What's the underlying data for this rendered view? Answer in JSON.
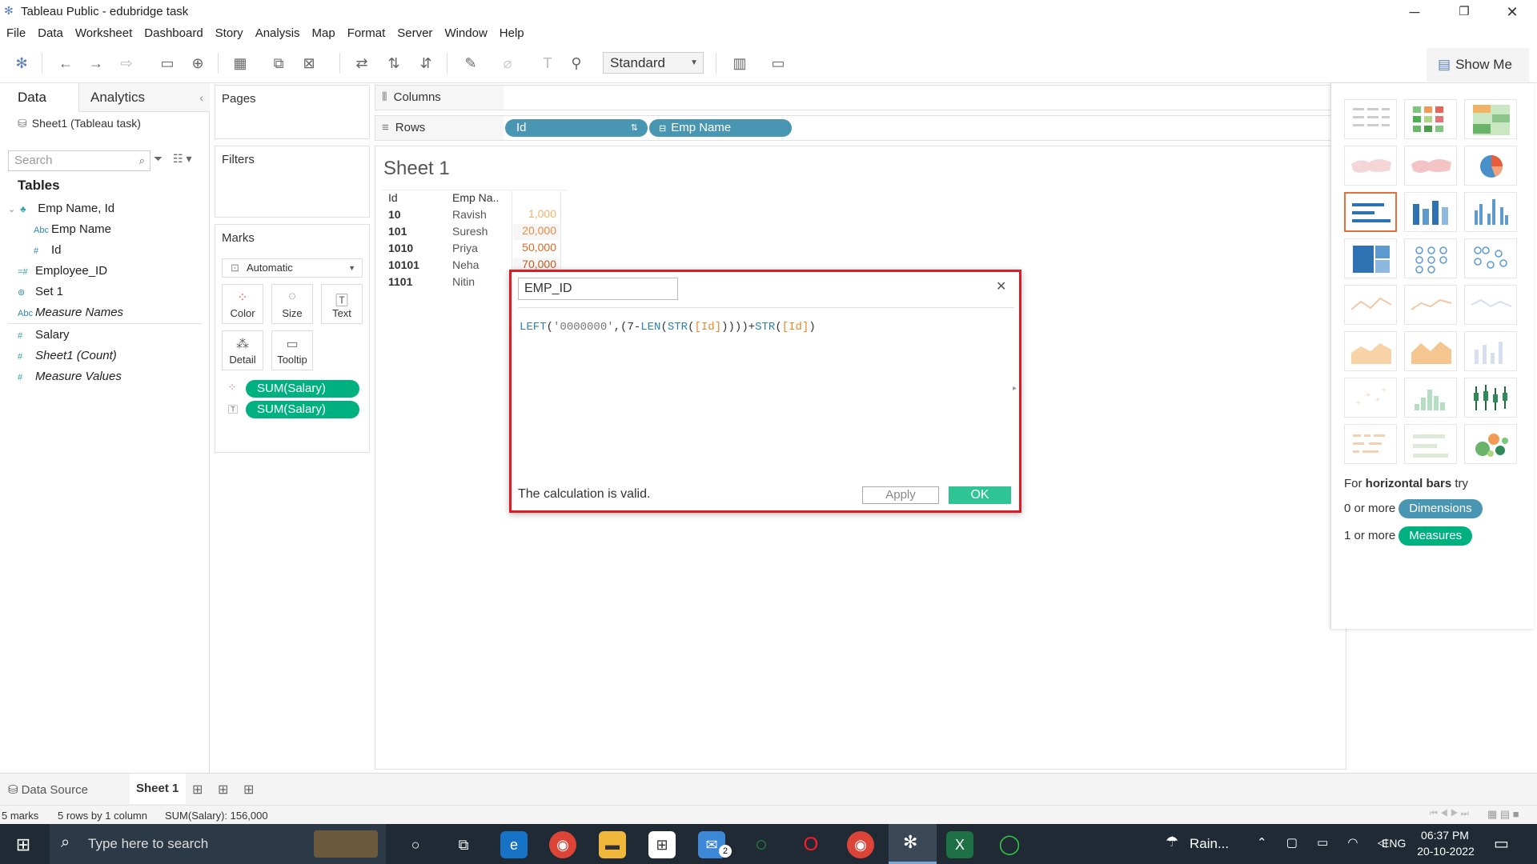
{
  "window": {
    "title": "Tableau Public - edubridge task"
  },
  "menu": [
    "File",
    "Data",
    "Worksheet",
    "Dashboard",
    "Story",
    "Analysis",
    "Map",
    "Format",
    "Server",
    "Window",
    "Help"
  ],
  "toolbar": {
    "fit_select": "Standard",
    "show_me_label": "Show Me"
  },
  "datapane": {
    "tab_data": "Data",
    "tab_analytics": "Analytics",
    "datasource": "Sheet1 (Tableau task)",
    "search_placeholder": "Search",
    "tables_heading": "Tables",
    "fields": [
      {
        "icon": "hierarchy",
        "label": "Emp Name, Id",
        "italic": false
      },
      {
        "icon": "Abc",
        "label": "Emp Name",
        "italic": false
      },
      {
        "icon": "#",
        "label": "Id",
        "italic": false
      },
      {
        "icon": "=#",
        "label": "Employee_ID",
        "italic": false
      },
      {
        "icon": "set",
        "label": "Set 1",
        "italic": false
      },
      {
        "icon": "Abc",
        "label": "Measure Names",
        "italic": true
      },
      {
        "icon": "#",
        "label": "Salary",
        "italic": false
      },
      {
        "icon": "=#",
        "label": "Sheet1 (Count)",
        "italic": true
      },
      {
        "icon": "#",
        "label": "Measure Values",
        "italic": true
      }
    ]
  },
  "shelves": {
    "pages": "Pages",
    "filters": "Filters",
    "columns": "Columns",
    "rows": "Rows",
    "row_pills": [
      "Id",
      "Emp Name"
    ]
  },
  "marks": {
    "title": "Marks",
    "type": "Automatic",
    "buttons": [
      "Color",
      "Size",
      "Text",
      "Detail",
      "Tooltip"
    ],
    "pills": [
      "SUM(Salary)",
      "SUM(Salary)"
    ]
  },
  "sheet": {
    "title": "Sheet 1",
    "headers": [
      "Id",
      "Emp Na.."
    ],
    "rows": [
      {
        "id": "10",
        "name": "Ravish",
        "value": "1,000"
      },
      {
        "id": "101",
        "name": "Suresh",
        "value": "20,000"
      },
      {
        "id": "1010",
        "name": "Priya",
        "value": "50,000"
      },
      {
        "id": "10101",
        "name": "Neha",
        "value": "70,000"
      },
      {
        "id": "1101",
        "name": "Nitin",
        "value": ""
      }
    ]
  },
  "calc_dialog": {
    "name": "EMP_ID",
    "status": "The calculation is valid.",
    "apply": "Apply",
    "ok": "OK",
    "formula_parts": [
      "LEFT",
      "(",
      "'0000000'",
      ",(7-",
      "LEN",
      "(",
      "STR",
      "(",
      "[Id]",
      "))))",
      "+",
      "STR",
      "(",
      "[Id]",
      ")"
    ]
  },
  "showme": {
    "hint_prefix": "For ",
    "hint_bold": "horizontal bars",
    "hint_suffix": " try",
    "dim_prefix": "0 or more",
    "dim_label": "Dimensions",
    "meas_prefix": "1 or more",
    "meas_label": "Measures"
  },
  "tabs": {
    "datasource": "Data Source",
    "sheet1": "Sheet 1"
  },
  "status": {
    "marks": "5 marks",
    "rows": "5 rows by 1 column",
    "sum": "SUM(Salary): 156,000"
  },
  "taskbar": {
    "search_placeholder": "Type here to search",
    "weather": "Rain...",
    "lang": "ENG",
    "time": "06:37 PM",
    "date": "20-10-2022",
    "mail_badge": "2"
  },
  "colors": {
    "green_pill": "#00b180",
    "blue_pill": "#4996b2",
    "dialog_border": "#e01b24",
    "ok": "#2ec493",
    "field_highlight": "#e58b2a"
  }
}
